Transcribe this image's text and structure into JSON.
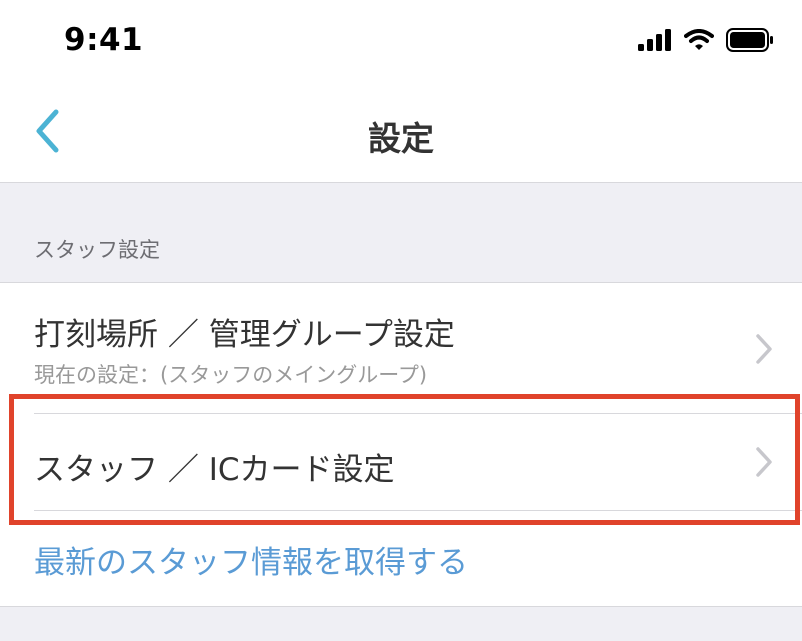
{
  "status_bar": {
    "time": "9:41",
    "icons": [
      "signal-icon",
      "wifi-icon",
      "battery-icon"
    ]
  },
  "nav": {
    "back_icon": "chevron-left-icon",
    "title": "設定"
  },
  "section": {
    "header": "スタッフ設定"
  },
  "rows": {
    "punch_location": {
      "title": "打刻場所 ／ 管理グループ設定",
      "subtitle": "現在の設定：(スタッフのメイングループ)"
    },
    "staff_ic": {
      "title": "スタッフ ／ ICカード設定"
    },
    "refresh": {
      "label": "最新のスタッフ情報を取得する"
    }
  },
  "colors": {
    "accent_blue": "#5a9bd5",
    "back_arrow": "#4cb3d4",
    "highlight_red": "#e0432b",
    "background": "#efeff4"
  }
}
